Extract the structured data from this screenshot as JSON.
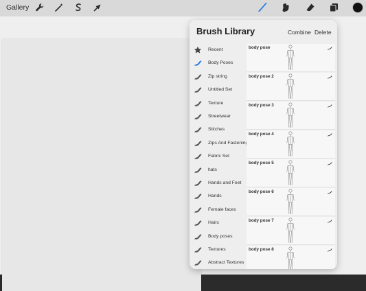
{
  "toolbar": {
    "gallery_label": "Gallery",
    "left_tools": [
      "wrench-icon",
      "magic-wand-icon",
      "selection-icon",
      "transform-icon"
    ],
    "right_tools": [
      "brush-icon",
      "smudge-icon",
      "eraser-icon",
      "layers-icon",
      "color-icon"
    ],
    "accent_color": "#2f7de1",
    "current_color": "#111111"
  },
  "panel": {
    "title": "Brush Library",
    "combine_label": "Combine",
    "delete_label": "Delete"
  },
  "sets": [
    {
      "label": "Recent",
      "icon": "star-icon"
    },
    {
      "label": "Body Poses",
      "icon": "brush-stroke-icon",
      "selected": true
    },
    {
      "label": "Zip string",
      "icon": "brush-stroke-icon"
    },
    {
      "label": "Untitled Set",
      "icon": "brush-stroke-icon"
    },
    {
      "label": "Texture",
      "icon": "brush-stroke-icon"
    },
    {
      "label": "Streetwear",
      "icon": "brush-stroke-icon"
    },
    {
      "label": "Stitches",
      "icon": "brush-stroke-icon"
    },
    {
      "label": "Zips And Fastening",
      "icon": "brush-stroke-icon"
    },
    {
      "label": "Fabric Set",
      "icon": "brush-stroke-icon"
    },
    {
      "label": "hats",
      "icon": "brush-stroke-icon"
    },
    {
      "label": "Hands and Feet",
      "icon": "brush-stroke-icon"
    },
    {
      "label": "Hands",
      "icon": "brush-stroke-icon"
    },
    {
      "label": "Female faces",
      "icon": "brush-stroke-icon"
    },
    {
      "label": "Hairs",
      "icon": "brush-stroke-icon"
    },
    {
      "label": "Body poses",
      "icon": "brush-stroke-icon"
    },
    {
      "label": "Textures",
      "icon": "brush-stroke-icon"
    },
    {
      "label": "Abstract Textures",
      "icon": "brush-stroke-icon"
    }
  ],
  "brushes": [
    {
      "name": "body pose"
    },
    {
      "name": "body pose 2"
    },
    {
      "name": "body pose 3"
    },
    {
      "name": "body pose 4"
    },
    {
      "name": "body pose 5"
    },
    {
      "name": "body pose 6"
    },
    {
      "name": "body pose 7"
    },
    {
      "name": "body pose 8"
    }
  ]
}
